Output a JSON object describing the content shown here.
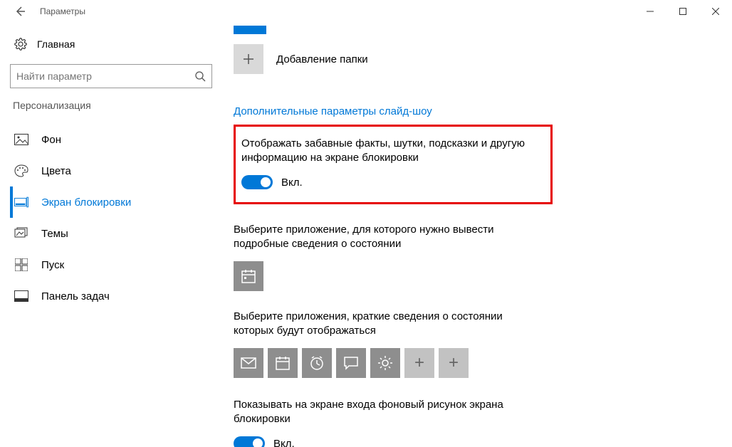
{
  "window": {
    "title": "Параметры"
  },
  "sidebar": {
    "home": "Главная",
    "search_placeholder": "Найти параметр",
    "category": "Персонализация",
    "items": [
      {
        "label": "Фон"
      },
      {
        "label": "Цвета"
      },
      {
        "label": "Экран блокировки"
      },
      {
        "label": "Темы"
      },
      {
        "label": "Пуск"
      },
      {
        "label": "Панель задач"
      }
    ]
  },
  "content": {
    "add_folder": "Добавление папки",
    "advanced_link": "Дополнительные параметры слайд-шоу",
    "fun_facts": {
      "text": "Отображать забавные факты, шутки, подсказки и другую информацию на экране блокировки",
      "state": "Вкл."
    },
    "detailed_app": {
      "text": "Выберите приложение, для которого нужно вывести подробные сведения о состоянии"
    },
    "quick_apps": {
      "text": "Выберите приложения, краткие сведения о состоянии которых будут отображаться"
    },
    "signin_bg": {
      "text": "Показывать на экране входа фоновый рисунок экрана блокировки",
      "state": "Вкл."
    }
  }
}
